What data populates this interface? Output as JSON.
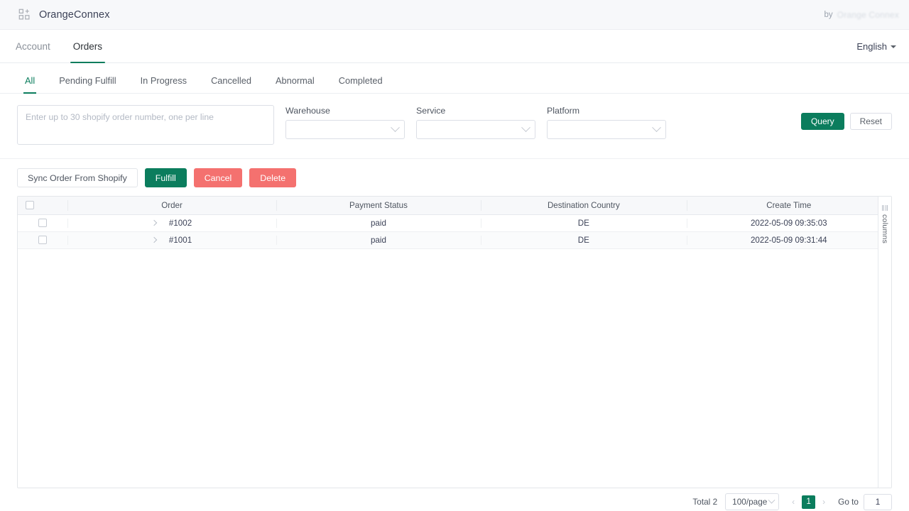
{
  "brand": {
    "app_name": "OrangeConnex",
    "icon": "apps-grid-plus-icon",
    "by_label": "by",
    "by_logo_text": "Orange Connex"
  },
  "mainnav": {
    "tabs": [
      {
        "label": "Account",
        "active": false
      },
      {
        "label": "Orders",
        "active": true
      }
    ],
    "language": "English"
  },
  "status_tabs": [
    {
      "label": "All",
      "active": true
    },
    {
      "label": "Pending Fulfill",
      "active": false
    },
    {
      "label": "In Progress",
      "active": false
    },
    {
      "label": "Cancelled",
      "active": false
    },
    {
      "label": "Abnormal",
      "active": false
    },
    {
      "label": "Completed",
      "active": false
    }
  ],
  "filters": {
    "order_numbers": {
      "value": "",
      "placeholder": "Enter up to 30 shopify order number, one per line"
    },
    "warehouse": {
      "label": "Warehouse",
      "value": ""
    },
    "service": {
      "label": "Service",
      "value": ""
    },
    "platform": {
      "label": "Platform",
      "value": ""
    },
    "query_label": "Query",
    "reset_label": "Reset"
  },
  "toolbar": {
    "sync_label": "Sync Order From Shopify",
    "fulfill_label": "Fulfill",
    "cancel_label": "Cancel",
    "delete_label": "Delete"
  },
  "table": {
    "columns": [
      "Order",
      "Payment Status",
      "Destination Country",
      "Create Time"
    ],
    "rows": [
      {
        "order": "#1002",
        "payment_status": "paid",
        "destination_country": "DE",
        "create_time": "2022-05-09 09:35:03",
        "selected": false
      },
      {
        "order": "#1001",
        "payment_status": "paid",
        "destination_country": "DE",
        "create_time": "2022-05-09 09:31:44",
        "selected": false
      }
    ],
    "columns_handle_label": "columns"
  },
  "pagination": {
    "total_label": "Total 2",
    "page_size": "100/page",
    "prev_icon": "chevron-left-icon",
    "next_icon": "chevron-right-icon",
    "current_page": "1",
    "goto_label": "Go to",
    "goto_value": "1"
  },
  "colors": {
    "primary_green": "#0b7d5d",
    "danger_red": "#f4716f",
    "header_bg": "#f7f8fa",
    "border": "#dcdfe6"
  }
}
